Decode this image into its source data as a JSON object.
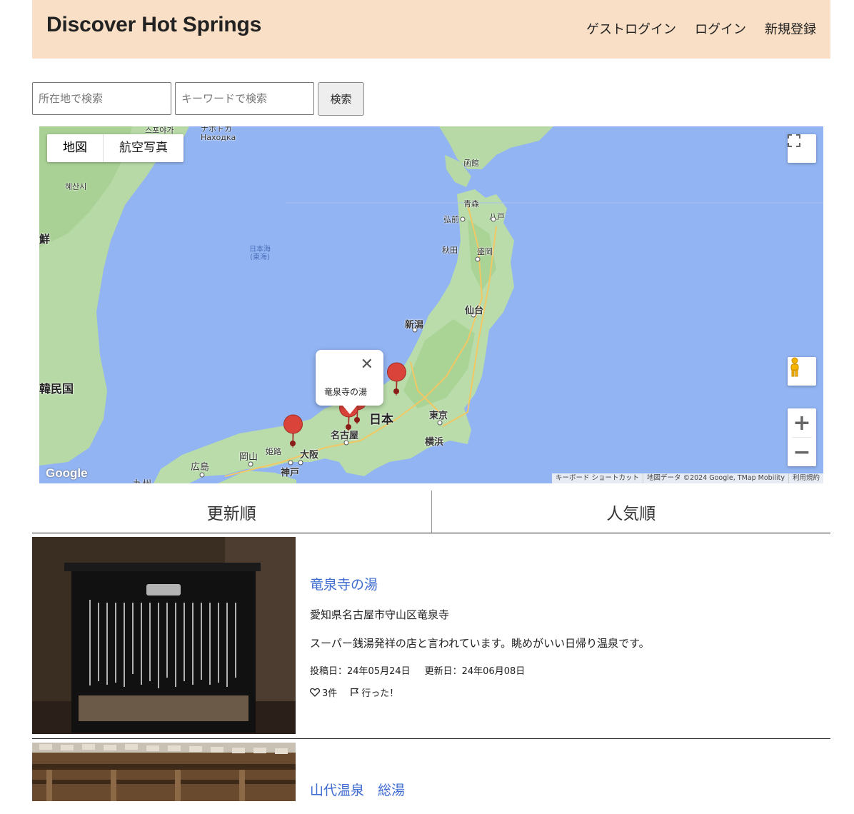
{
  "header": {
    "brand": "Discover Hot Springs",
    "nav": [
      "ゲストログイン",
      "ログイン",
      "新規登録"
    ]
  },
  "search": {
    "location_placeholder": "所在地で検索",
    "keyword_placeholder": "キーワードで検索",
    "button": "検索"
  },
  "map": {
    "type_map": "地図",
    "type_satellite": "航空写真",
    "infowindow_text": "竜泉寺の湯",
    "google_logo": "Google",
    "attribution": [
      "キーボード ショートカット",
      "地図データ ©2024 Google, TMap Mobility",
      "利用規約"
    ],
    "labels": {
      "seoul_area": "스포야가",
      "nakhodka": "ナホトカ\nНаходка",
      "hyesan": "혜산시",
      "korea_partial": "鮮",
      "kor_republic": "韓民国",
      "sea_of_japan": "日本海\n(東海)",
      "hakodate": "函館",
      "aomori": "青森",
      "hirosaki": "弘前",
      "hachinohe": "八戸",
      "akita": "秋田",
      "morioka": "盛岡",
      "sendai": "仙台",
      "niigata": "新潟",
      "japan": "日本",
      "tokyo": "東京",
      "yokohama": "横浜",
      "nagoya": "名古屋",
      "osaka": "大阪",
      "kobe": "神戸",
      "himeji": "姫路",
      "okayama": "岡山",
      "hiroshima": "広島",
      "kyushu": "九州"
    },
    "colors": {
      "sea": "#92b4f2",
      "land": "#b9dcaa",
      "marker": "#d9433a"
    }
  },
  "tabs": [
    "更新順",
    "人気順"
  ],
  "posts": [
    {
      "title": "竜泉寺の湯",
      "address": "愛知県名古屋市守山区竜泉寺",
      "description": "スーパー銭湯発祥の店と言われています。眺めがいい日帰り温泉です。",
      "posted": "投稿日：24年05月24日",
      "updated": "更新日：24年06月08日",
      "likes": "3件",
      "visited": "行った！"
    },
    {
      "title": "山代温泉　総湯"
    }
  ]
}
